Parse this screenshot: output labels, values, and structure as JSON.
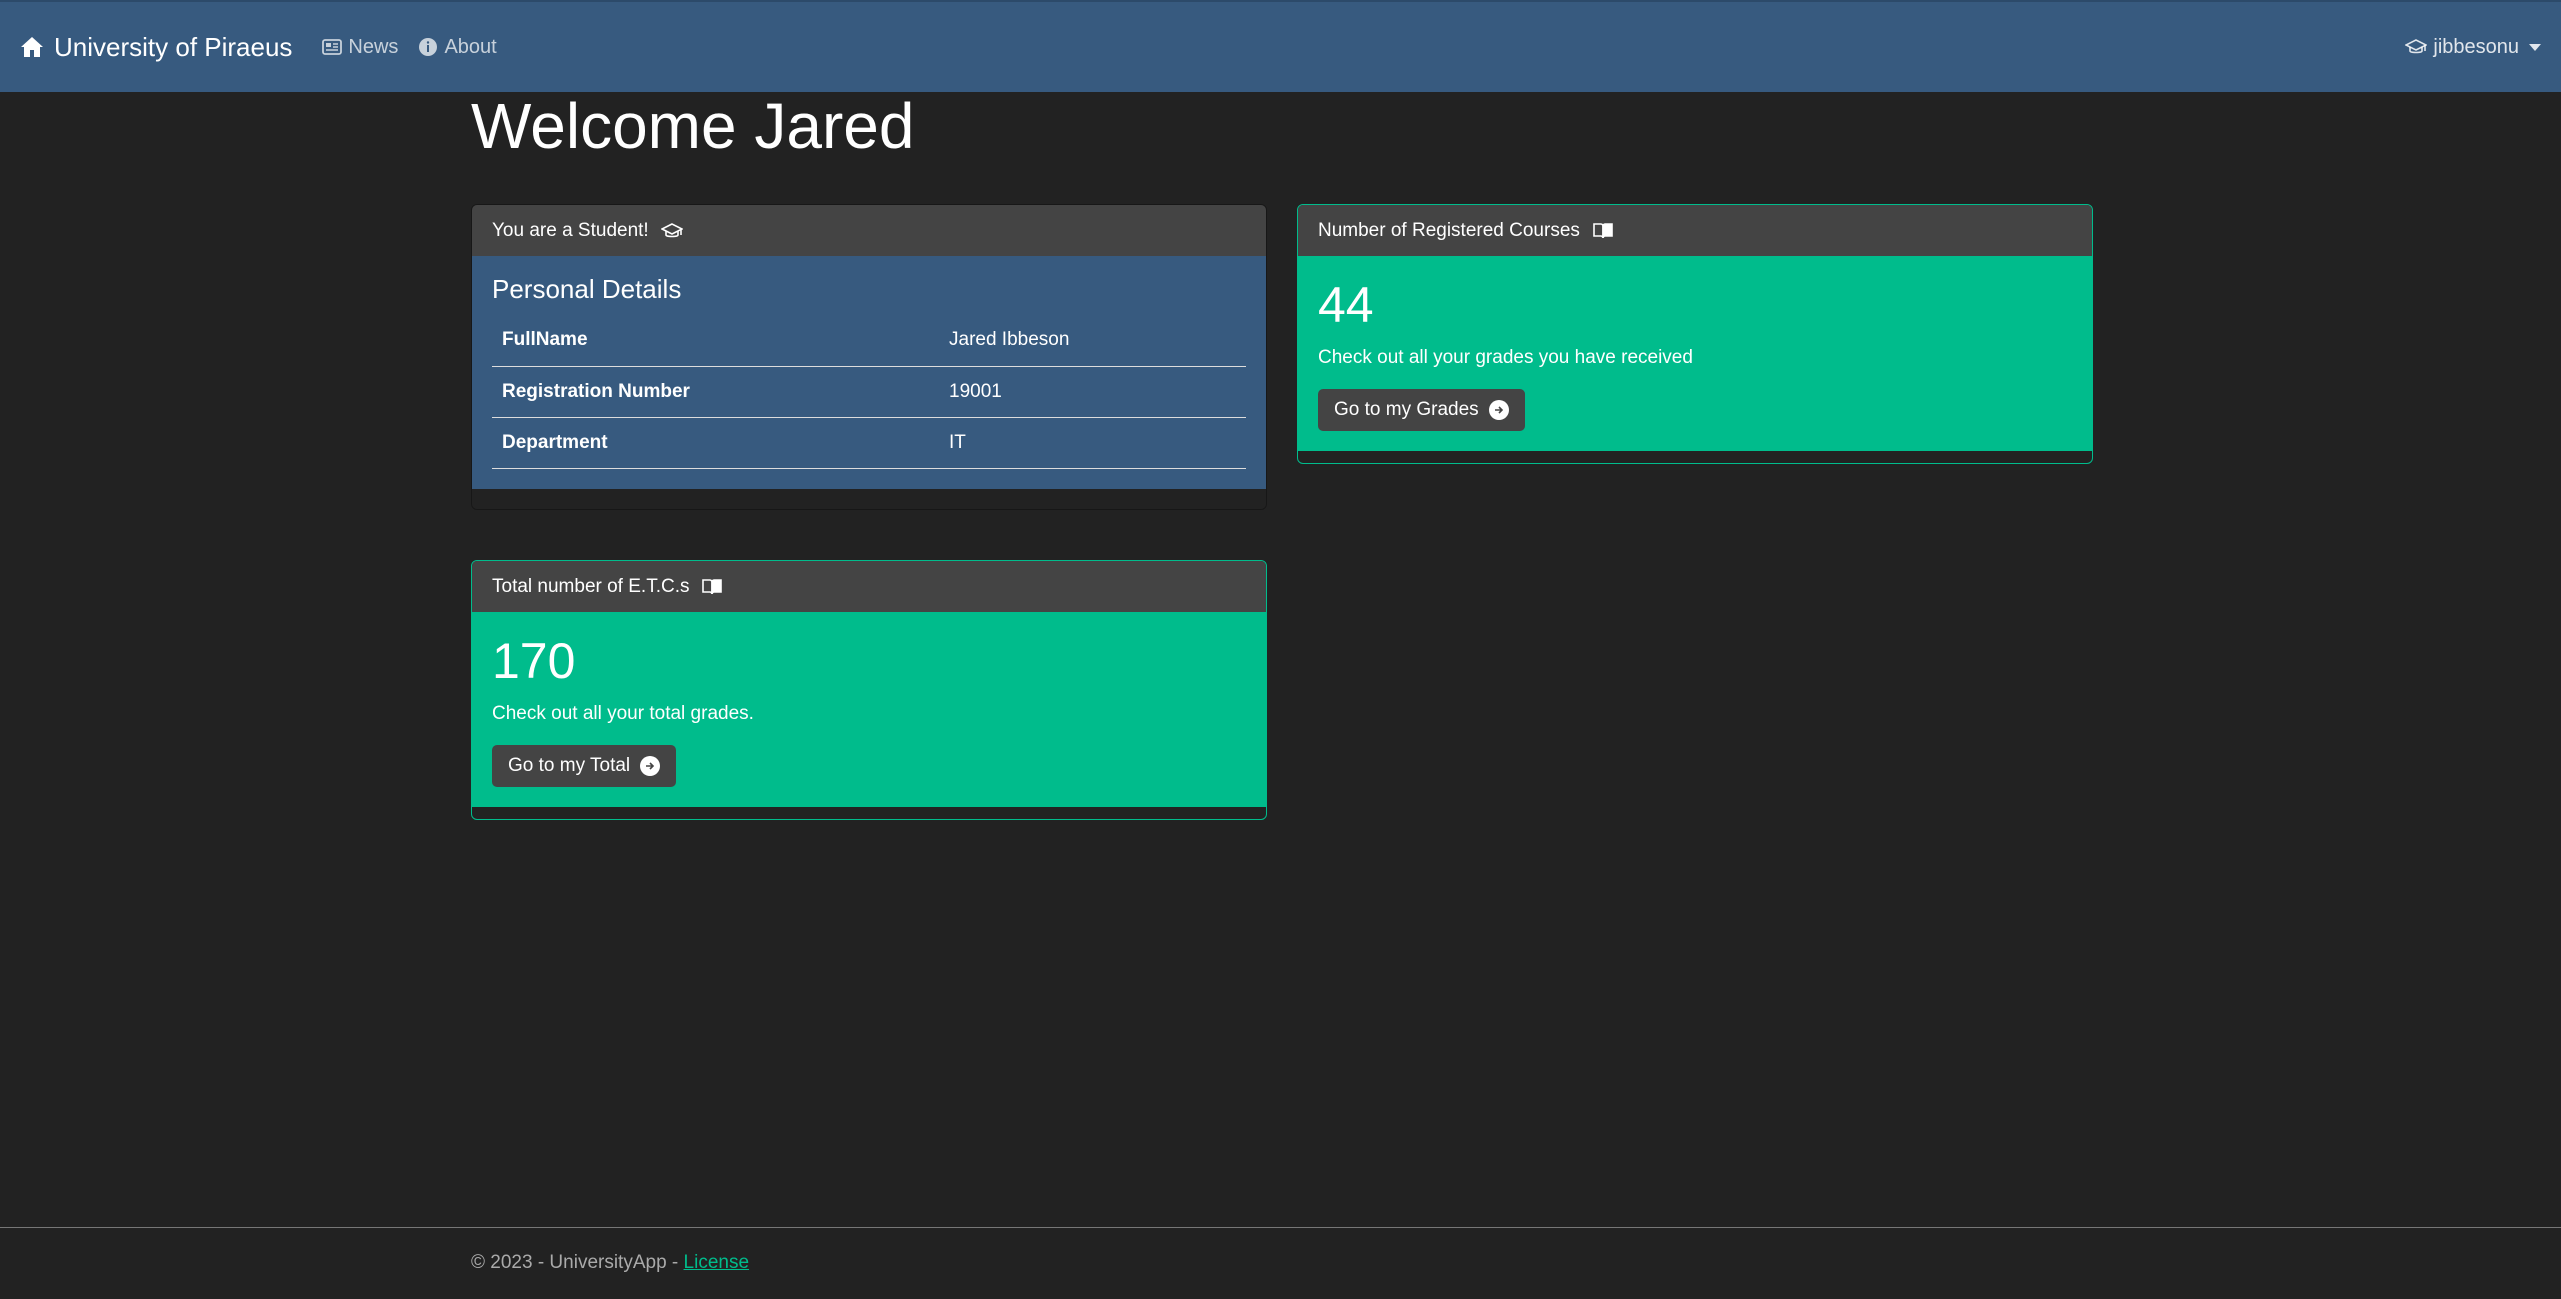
{
  "navbar": {
    "brand": "University of Piraeus",
    "links": [
      {
        "label": "News",
        "icon": "newspaper-icon"
      },
      {
        "label": "About",
        "icon": "info-icon"
      }
    ],
    "user": {
      "label": "jibbesonu",
      "icon": "graduation-cap-icon"
    }
  },
  "page": {
    "title": "Welcome Jared"
  },
  "student_card": {
    "header": "You are a Student!",
    "section_title": "Personal Details",
    "rows": [
      {
        "label": "FullName",
        "value": "Jared Ibbeson"
      },
      {
        "label": "Registration Number",
        "value": "19001"
      },
      {
        "label": "Department",
        "value": "IT"
      }
    ]
  },
  "courses_card": {
    "header": "Number of Registered Courses",
    "count": "44",
    "text": "Check out all your grades you have received",
    "button": "Go to my Grades"
  },
  "etcs_card": {
    "header": "Total number of E.T.C.s",
    "count": "170",
    "text": "Check out all your total grades.",
    "button": "Go to my Total"
  },
  "footer": {
    "text": "© 2023 - UniversityApp - ",
    "link": "License"
  },
  "colors": {
    "navbar": "#375a7f",
    "background": "#222222",
    "card_header": "#444444",
    "success": "#00bc8c"
  }
}
